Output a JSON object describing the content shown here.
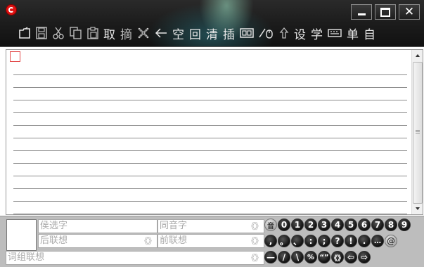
{
  "toolbar": {
    "items": [
      {
        "kind": "icon",
        "name": "open-icon"
      },
      {
        "kind": "icon",
        "name": "save-icon"
      },
      {
        "kind": "icon",
        "name": "cut-icon"
      },
      {
        "kind": "icon",
        "name": "copy-icon"
      },
      {
        "kind": "icon",
        "name": "paste-icon"
      },
      {
        "kind": "text",
        "label": "取"
      },
      {
        "kind": "text",
        "label": "摘"
      },
      {
        "kind": "icon",
        "name": "clear-x-icon"
      },
      {
        "kind": "icon",
        "name": "backspace-arrow-icon"
      },
      {
        "kind": "text",
        "label": "空"
      },
      {
        "kind": "text",
        "label": "回"
      },
      {
        "kind": "text",
        "label": "清"
      },
      {
        "kind": "text",
        "label": "插"
      },
      {
        "kind": "icon",
        "name": "fullwidth-icon"
      },
      {
        "kind": "icon",
        "name": "handwriting-mouse-icon"
      },
      {
        "kind": "icon",
        "name": "shift-up-icon"
      },
      {
        "kind": "text",
        "label": "设"
      },
      {
        "kind": "text",
        "label": "学"
      },
      {
        "kind": "icon",
        "name": "keyboard-icon"
      },
      {
        "kind": "text",
        "label": "单"
      },
      {
        "kind": "text",
        "label": "自"
      }
    ]
  },
  "panel": {
    "candidates_label": "侯选字",
    "homophones_label": "同音字",
    "post_assoc_label": "后联想",
    "pre_assoc_label": "前联想",
    "phrase_assoc_label": "词组联想",
    "pager": "《》"
  },
  "keypad": {
    "tone_label": "音",
    "digits": [
      "0",
      "1",
      "2",
      "3",
      "4",
      "5",
      "6",
      "7",
      "8",
      "9"
    ],
    "row2": [
      ",",
      "。",
      "、",
      ":",
      ";",
      "?",
      "!",
      ".",
      "…",
      "@"
    ],
    "row3": [
      "—",
      "/",
      "\\",
      "%",
      "“”",
      "《》",
      "⇦",
      "⇨"
    ]
  },
  "colors": {
    "titlebar": "#1b1b1b",
    "panel_bg": "#bdbdbd",
    "placeholder_text": "#aaaaaa",
    "cursor_box": "#e24a4a"
  }
}
